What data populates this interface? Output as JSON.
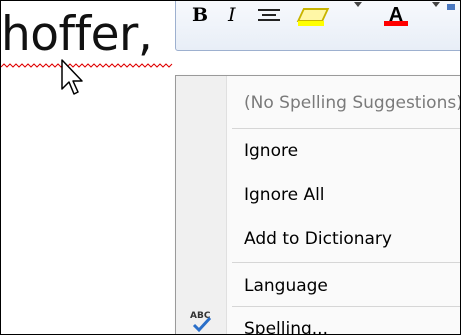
{
  "document": {
    "word": "hoffer,"
  },
  "mini_toolbar": {
    "bold_label": "B",
    "italic_label": "I",
    "font_color_label": "A",
    "highlight_color": "#ffff00",
    "font_color": "#ff0000"
  },
  "context_menu": {
    "items": [
      {
        "label": "(No Spelling Suggestions)",
        "enabled": false
      },
      {
        "label": "Ignore",
        "enabled": true
      },
      {
        "label": "Ignore All",
        "enabled": true
      },
      {
        "label": "Add to Dictionary",
        "enabled": true
      },
      {
        "label": "Language",
        "enabled": true
      },
      {
        "label": "Spelling...",
        "enabled": true,
        "icon": "abc-spell-check-icon"
      }
    ]
  }
}
